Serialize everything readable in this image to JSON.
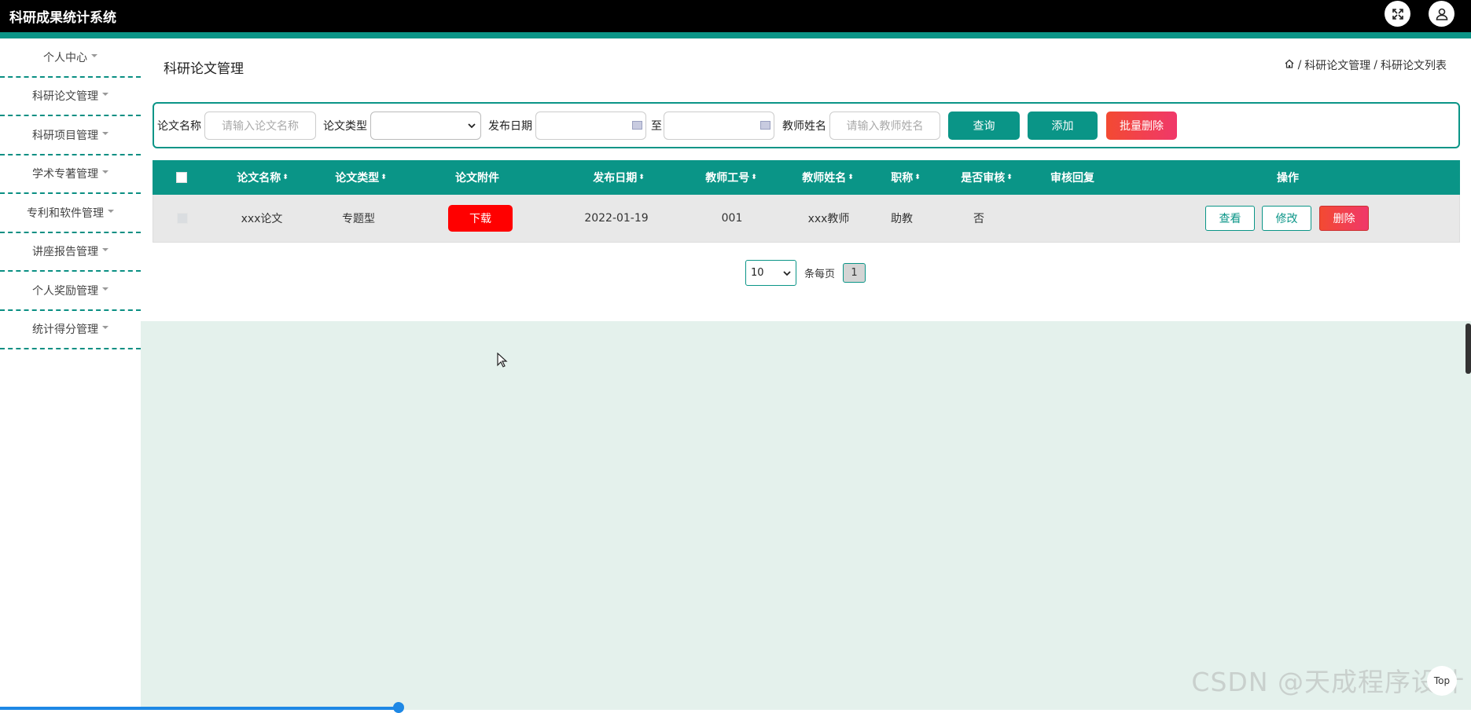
{
  "app": {
    "title": "科研成果统计系统"
  },
  "sidebar": {
    "items": [
      {
        "label": "个人中心"
      },
      {
        "label": "科研论文管理"
      },
      {
        "label": "科研项目管理"
      },
      {
        "label": "学术专著管理"
      },
      {
        "label": "专利和软件管理"
      },
      {
        "label": "讲座报告管理"
      },
      {
        "label": "个人奖励管理"
      },
      {
        "label": "统计得分管理"
      }
    ]
  },
  "page": {
    "title": "科研论文管理",
    "breadcrumb": [
      "科研论文管理",
      "科研论文列表"
    ]
  },
  "search": {
    "name_label": "论文名称",
    "name_placeholder": "请输入论文名称",
    "type_label": "论文类型",
    "date_label": "发布日期",
    "date_to": "至",
    "teacher_label": "教师姓名",
    "teacher_placeholder": "请输入教师姓名",
    "query_btn": "查询",
    "add_btn": "添加",
    "batch_delete_btn": "批量删除"
  },
  "table": {
    "headers": [
      "论文名称",
      "论文类型",
      "论文附件",
      "发布日期",
      "教师工号",
      "教师姓名",
      "职称",
      "是否审核",
      "审核回复",
      "操作"
    ],
    "rows": [
      {
        "name": "xxx论文",
        "type": "专题型",
        "attachment_btn": "下载",
        "date": "2022-01-19",
        "teacher_id": "001",
        "teacher_name": "xxx教师",
        "title": "助教",
        "reviewed": "否",
        "reply": "",
        "view_btn": "查看",
        "edit_btn": "修改",
        "delete_btn": "删除"
      }
    ]
  },
  "pagination": {
    "page_size": "10",
    "per_page_label": "条每页",
    "current_page": "1"
  },
  "watermark": "CSDN @天成程序设计",
  "top_label": "Top",
  "colors": {
    "accent": "#0a9587",
    "danger": "#f34a32",
    "download": "#ff0000"
  }
}
